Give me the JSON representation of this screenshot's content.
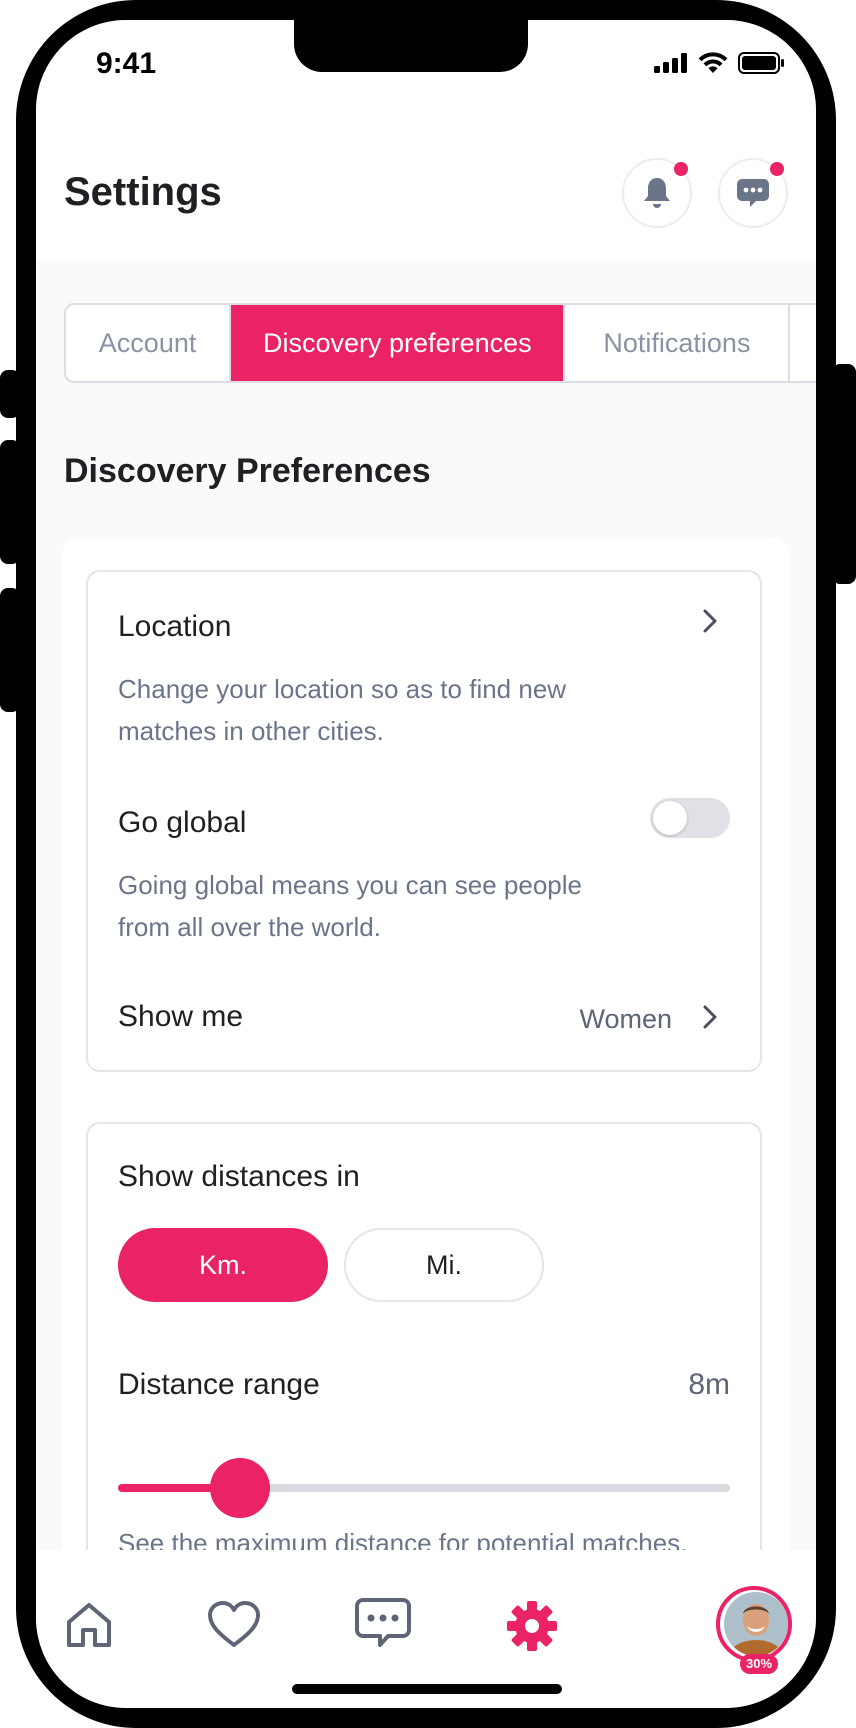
{
  "status_bar": {
    "time": "9:41"
  },
  "header": {
    "title": "Settings",
    "notification_badge": true,
    "messages_badge": true
  },
  "tabs": [
    {
      "label": "Account",
      "active": false
    },
    {
      "label": "Discovery preferences",
      "active": true
    },
    {
      "label": "Notifications",
      "active": false
    }
  ],
  "section": {
    "title": "Discovery Preferences"
  },
  "location": {
    "title": "Location",
    "description": "Change your location so as to find new matches in other cities."
  },
  "go_global": {
    "title": "Go global",
    "description": "Going global means you can see people from all over the world.",
    "enabled": false
  },
  "show_me": {
    "label": "Show me",
    "value": "Women"
  },
  "distance_units": {
    "title": "Show distances in",
    "options": [
      {
        "label": "Km.",
        "selected": true
      },
      {
        "label": "Mi.",
        "selected": false
      }
    ]
  },
  "distance_range": {
    "title": "Distance range",
    "value": "8m",
    "slider_fraction": 0.2,
    "description": "See the maximum distance for potential matches."
  },
  "bottom_nav": {
    "items": [
      "home-icon",
      "heart-icon",
      "chat-icon",
      "settings-icon",
      "profile-avatar"
    ],
    "active": "settings-icon",
    "profile_completion": "30%"
  },
  "colors": {
    "accent": "#ea2266",
    "muted_text": "#6b7589",
    "border": "#e3e5ea"
  }
}
